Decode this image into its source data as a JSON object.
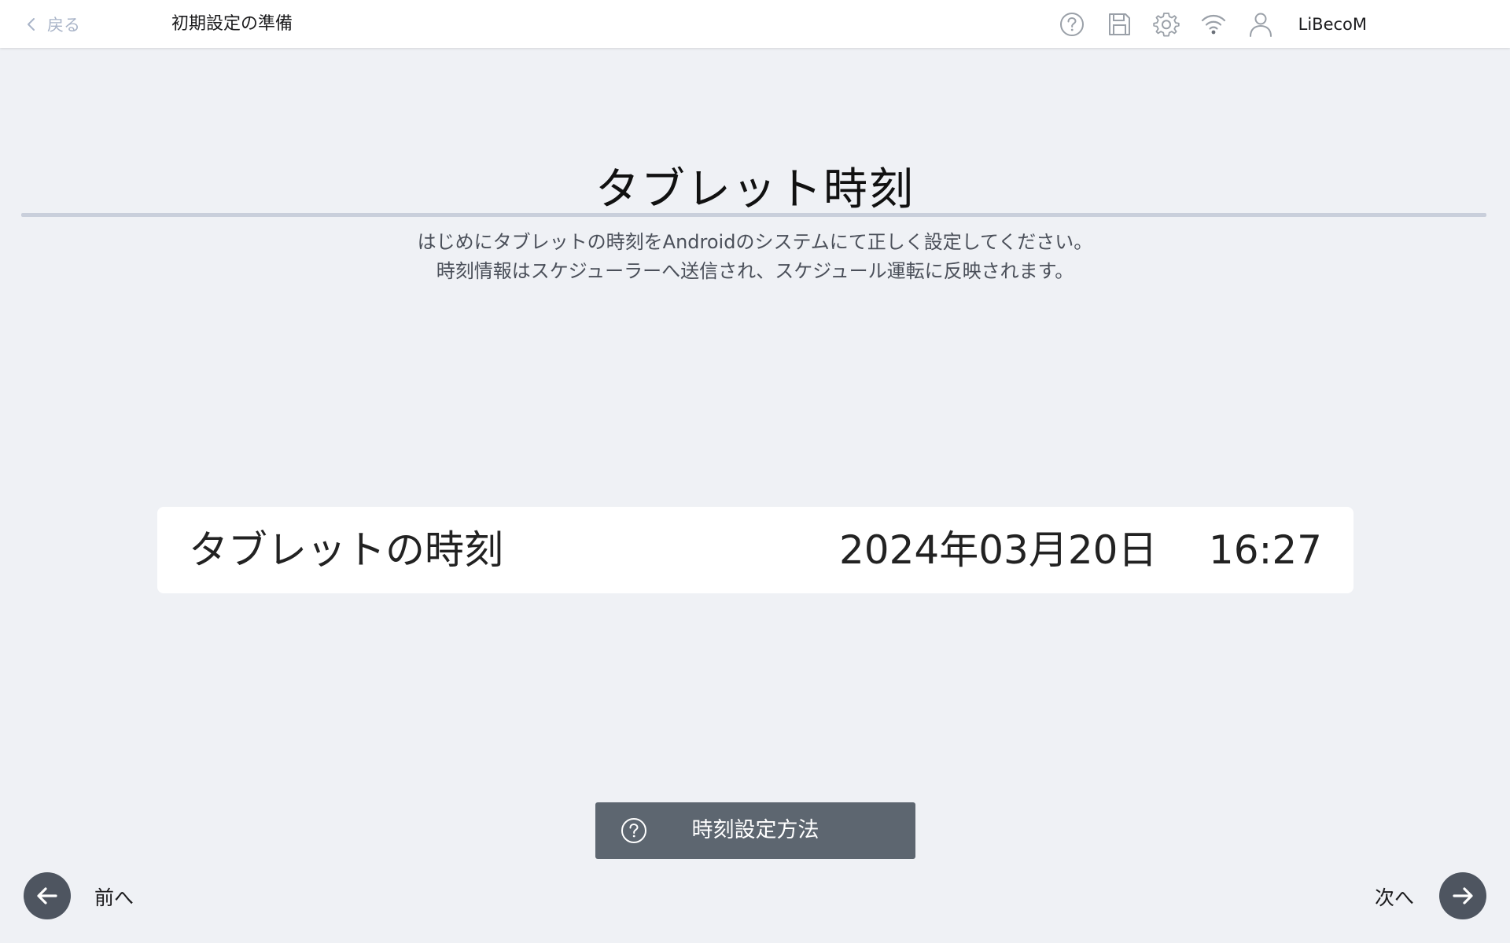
{
  "header": {
    "back_label": "戻る",
    "title": "初期設定の準備",
    "icons": [
      "help-icon",
      "save-icon",
      "gear-icon",
      "wifi-icon",
      "user-icon"
    ],
    "username": "LiBecoM"
  },
  "page": {
    "title": "タブレット時刻",
    "description_line1": "はじめにタブレットの時刻をAndroidのシステムにて正しく設定してください。",
    "description_line2": "時刻情報はスケジューラーへ送信され、スケジュール運転に反映されます。"
  },
  "time_card": {
    "label": "タブレットの時刻",
    "date": "2024年03月20日",
    "time": "16:27"
  },
  "help_button": {
    "label": "時刻設定方法"
  },
  "footer": {
    "prev_label": "前へ",
    "next_label": "次へ"
  },
  "colors": {
    "background": "#eff1f5",
    "topbar": "#ffffff",
    "back_text": "#a9b4c8",
    "help_button": "#5d6670",
    "nav_button": "#4e5560",
    "divider": "#c9cfdb"
  }
}
